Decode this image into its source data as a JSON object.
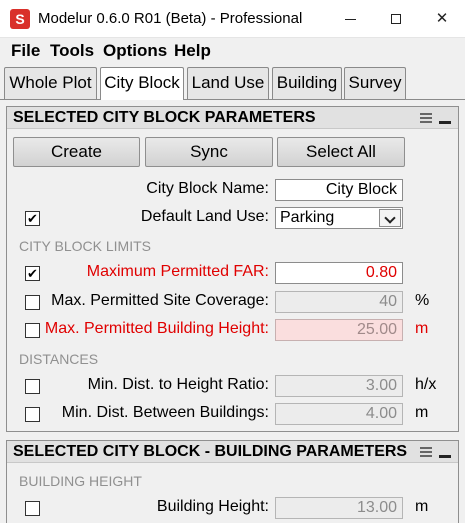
{
  "window": {
    "title": "Modelur 0.6.0 R01 (Beta) - Professional",
    "app_icon": "modelur-app-icon"
  },
  "menu": [
    "File",
    "Tools",
    "Options",
    "Help"
  ],
  "tabs": [
    "Whole Plot",
    "City Block",
    "Land Use",
    "Building",
    "Survey"
  ],
  "active_tab": "City Block",
  "panel1": {
    "title": "SELECTED CITY BLOCK PARAMETERS",
    "buttons": {
      "create": "Create",
      "sync": "Sync",
      "select_all": "Select All"
    },
    "city_block_name": {
      "label": "City Block Name:",
      "value": "City Block"
    },
    "default_land_use": {
      "label": "Default Land Use:",
      "value": "Parking",
      "checked": true
    },
    "limits_section": "CITY BLOCK LIMITS",
    "limits": [
      {
        "label": "Maximum Permitted FAR:",
        "value": "0.80",
        "unit": "",
        "checked": true
      },
      {
        "label": "Max. Permitted Site Coverage:",
        "value": "40",
        "unit": "%",
        "checked": false
      },
      {
        "label": "Max. Permitted Building Height:",
        "value": "25.00",
        "unit": "m",
        "checked": false
      }
    ],
    "distances_section": "DISTANCES",
    "distances": [
      {
        "label": "Min. Dist. to Height Ratio:",
        "value": "3.00",
        "unit": "h/x",
        "checked": false
      },
      {
        "label": "Min. Dist. Between Buildings:",
        "value": "4.00",
        "unit": "m",
        "checked": false
      }
    ]
  },
  "panel2": {
    "title": "SELECTED CITY BLOCK - BUILDING PARAMETERS",
    "height_section": "BUILDING HEIGHT",
    "building_height": {
      "label": "Building Height:",
      "value": "13.00",
      "unit": "m",
      "checked": false
    }
  },
  "colors": {
    "alert_red": "#e00000",
    "pink_field": "#fadede",
    "accent_icon": "#d9302a"
  }
}
